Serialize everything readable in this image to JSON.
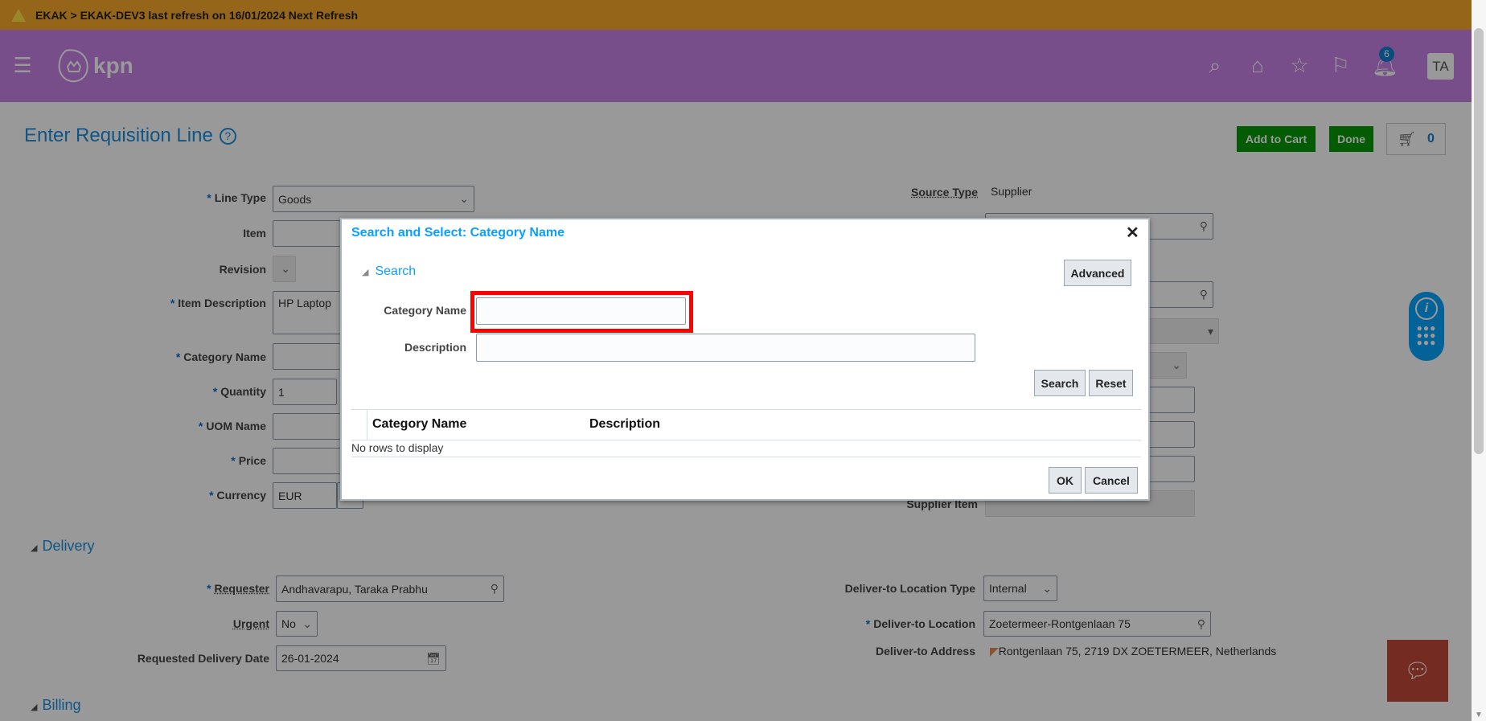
{
  "banner": {
    "text": "EKAK > EKAK-DEV3 last refresh on 16/01/2024 Next Refresh",
    "icon": "warning-icon"
  },
  "header": {
    "logo": "kpn",
    "notifications": "6",
    "avatar": "TA"
  },
  "page": {
    "title": "Enter Requisition Line",
    "help": "?",
    "add_to_cart": "Add to Cart",
    "done": "Done",
    "cart_count": "0"
  },
  "form": {
    "line_type": {
      "label": "Line Type",
      "value": "Goods"
    },
    "item": {
      "label": "Item",
      "value": ""
    },
    "revision": {
      "label": "Revision"
    },
    "item_description": {
      "label": "Item Description",
      "value": "HP Laptop"
    },
    "category_name": {
      "label": "Category Name",
      "value": ""
    },
    "quantity": {
      "label": "Quantity",
      "value": "1"
    },
    "uom_name": {
      "label": "UOM Name",
      "value": ""
    },
    "price": {
      "label": "Price",
      "value": ""
    },
    "currency": {
      "label": "Currency",
      "value": "EUR"
    },
    "source_type": {
      "label": "Source Type",
      "value": "Supplier"
    },
    "supplier_item": {
      "label": "Supplier Item"
    }
  },
  "delivery": {
    "section": "Delivery",
    "requester": {
      "label": "Requester",
      "value": "Andhavarapu, Taraka Prabhu"
    },
    "urgent": {
      "label": "Urgent",
      "value": "No"
    },
    "date": {
      "label": "Requested Delivery Date",
      "value": "26-01-2024"
    },
    "loc_type": {
      "label": "Deliver-to Location Type",
      "value": "Internal"
    },
    "location": {
      "label": "Deliver-to Location",
      "value": "Zoetermeer-Rontgenlaan 75"
    },
    "address": {
      "label": "Deliver-to Address",
      "value": "Rontgenlaan 75, 2719 DX ZOETERMEER, Netherlands"
    }
  },
  "billing": {
    "section": "Billing"
  },
  "dialog": {
    "title": "Search and Select: Category Name",
    "search_header": "Search",
    "advanced": "Advanced",
    "category_label": "Category Name",
    "category_value": "",
    "description_label": "Description",
    "description_value": "",
    "search_btn": "Search",
    "reset_btn": "Reset",
    "columns": [
      "Category Name",
      "Description"
    ],
    "empty": "No rows to display",
    "ok": "OK",
    "cancel": "Cancel"
  },
  "colors": {
    "banner": "#f8a82a",
    "header": "#c983e6",
    "accent": "#1a8fe0",
    "green": "#069a06",
    "highlight": "#ff0000"
  }
}
